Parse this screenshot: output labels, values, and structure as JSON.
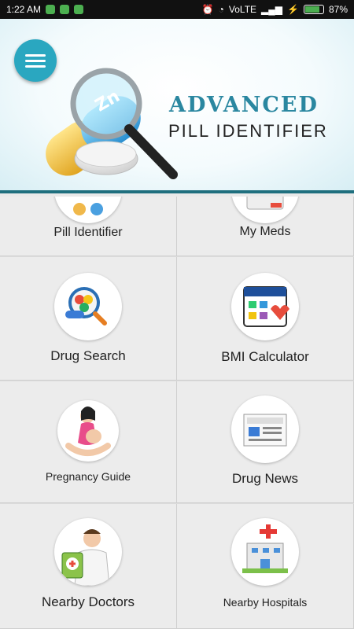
{
  "status_bar": {
    "time": "1:22 AM",
    "network": "VoLTE",
    "battery": "87%",
    "battery_level": 0.87
  },
  "header": {
    "title_line1": "ADVANCED",
    "title_line2": "PILL IDENTIFIER",
    "pill_text": "Zn"
  },
  "tiles": [
    {
      "label": "Pill Identifier",
      "icon": "pill-icon"
    },
    {
      "label": "My Meds",
      "icon": "calendar-icon"
    },
    {
      "label": "Drug Search",
      "icon": "drug-search-icon"
    },
    {
      "label": "BMI Calculator",
      "icon": "bmi-calculator-icon"
    },
    {
      "label": "Pregnancy Guide",
      "icon": "pregnancy-icon"
    },
    {
      "label": "Drug News",
      "icon": "newspaper-icon"
    },
    {
      "label": "Nearby Doctors",
      "icon": "doctor-icon"
    },
    {
      "label": "Nearby Hospitals",
      "icon": "hospital-icon"
    }
  ],
  "colors": {
    "accent": "#2aa7c0",
    "header_border": "#1f6f7e",
    "tile_bg": "#ececec"
  }
}
